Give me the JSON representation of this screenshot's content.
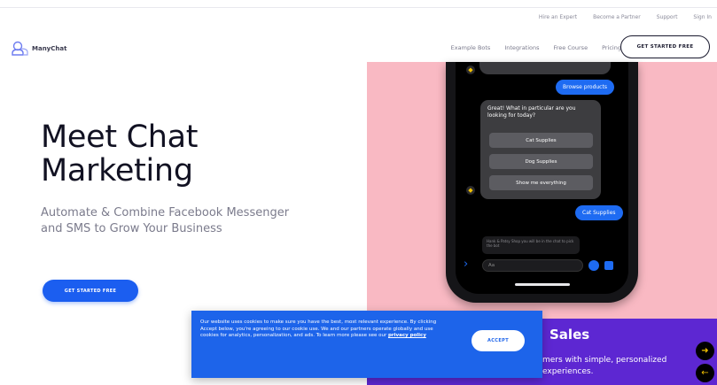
{
  "utility_nav": [
    "Hire an Expert",
    "Become a Partner",
    "Support",
    "Sign In"
  ],
  "brand": {
    "name": "ManyChat"
  },
  "main_nav": [
    "Example Bots",
    "Integrations",
    "Free Course",
    "Pricing"
  ],
  "header_cta": "GET STARTED FREE",
  "hero": {
    "title_line1": "Meet Chat",
    "title_line2": "Marketing",
    "subtitle": "Automate & Combine Facebook Messenger and SMS to Grow Your Business",
    "cta": "GET STARTED FREE"
  },
  "chat": {
    "user_msg_1": "Browse products",
    "bot_msg": "Great! What in particular are you looking for today?",
    "quick_replies": [
      "Cat Supplies",
      "Dog Supplies",
      "Show me everything"
    ],
    "user_msg_2": "Cat Supplies",
    "typing_note": "Hank & Patsy Shop you will be in the chat to pick the bot",
    "input_placeholder": "Aa"
  },
  "sales": {
    "title": "Sales",
    "subtitle": "mers with simple, personalized experiences."
  },
  "cookie": {
    "text": "Our website uses cookies to make sure you have the best, most relevant experience. By clicking Accept below, you're agreeing to our cookie use. We and our partners operate globally and use cookies for analytics, personalization, and ads. To learn more please see our",
    "policy_link": "privacy policy",
    "accept": "ACCEPT"
  },
  "colors": {
    "brand_blue": "#1b5ef0",
    "pink_bg": "#f9b9c3",
    "purple_bg": "#5d27d2",
    "cookie_blue": "#1d64ea"
  }
}
